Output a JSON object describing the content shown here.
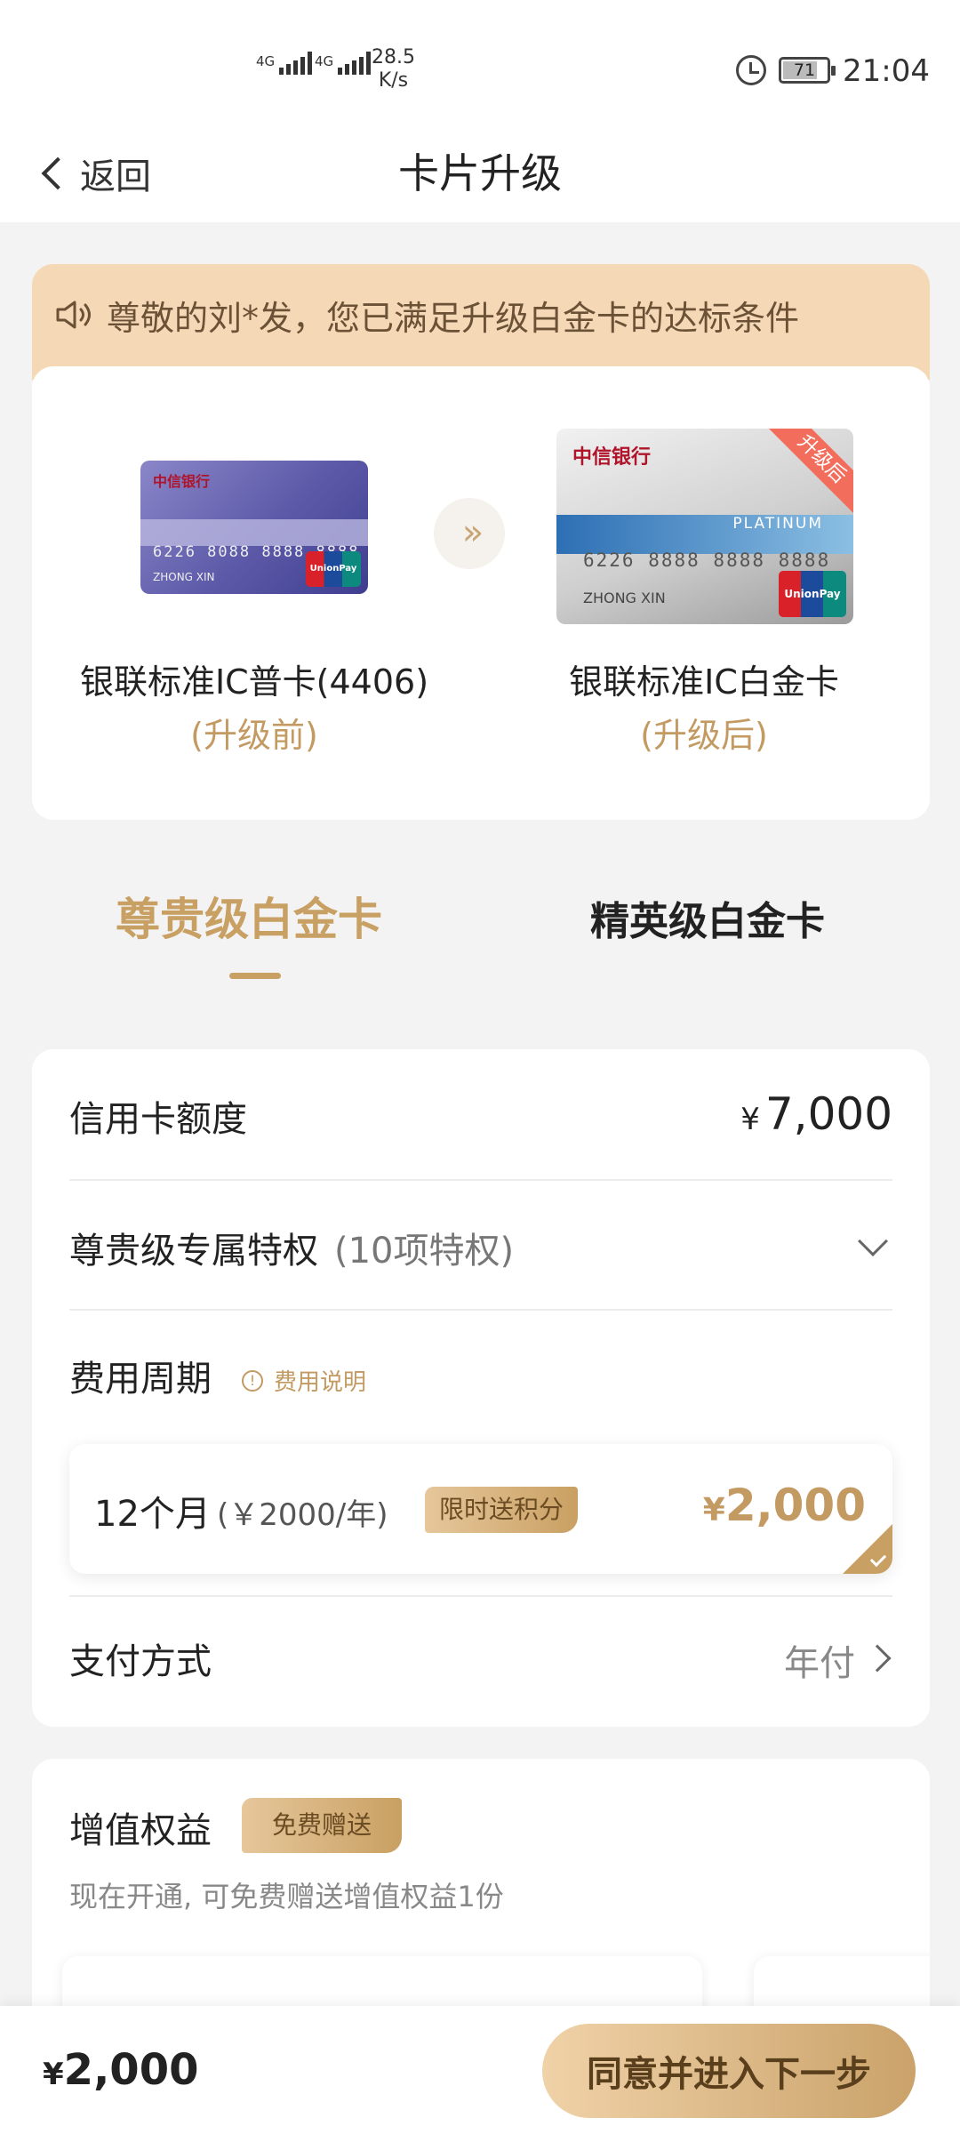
{
  "status_bar": {
    "net1": "4G",
    "net2": "4G",
    "speed_value": "28.5",
    "speed_unit": "K/s",
    "battery": "71",
    "time": "21:04"
  },
  "header": {
    "back_label": "返回",
    "title": "卡片升级"
  },
  "notice": {
    "text": "尊敬的刘*发，您已满足升级白金卡的达标条件"
  },
  "upgrade": {
    "before": {
      "name": "银联标准IC普卡(4406)",
      "sub": "(升级前)",
      "bank": "中信银行",
      "number": "6226 8088 8888 8888",
      "holder": "ZHONG XIN",
      "network": "UnionPay 银联"
    },
    "after": {
      "name": "银联标准IC白金卡",
      "sub": "(升级后)",
      "bank": "中信银行",
      "number": "6226 8888 8888 8888",
      "holder": "ZHONG XIN",
      "level": "PLATINUM",
      "network": "UnionPay 银联",
      "ribbon": "升级后"
    },
    "arrow": "»"
  },
  "tabs": [
    {
      "label": "尊贵级白金卡",
      "active": true
    },
    {
      "label": "精英级白金卡",
      "active": false
    }
  ],
  "details": {
    "limit_label": "信用卡额度",
    "limit_currency": "¥",
    "limit_value": "7,000",
    "privilege_label": "尊贵级专属特权",
    "privilege_count": "(10项特权)",
    "fee_label": "费用周期",
    "fee_note": "费用说明",
    "period": {
      "label": "12个月",
      "price": "(￥2000/年)",
      "promo": "限时送积分",
      "currency": "¥",
      "amount": "2,000",
      "selected": true
    },
    "payment_label": "支付方式",
    "payment_value": "年付"
  },
  "value_add": {
    "title": "增值权益",
    "tag": "免费赠送",
    "subtitle": "现在开通, 可免费赠送增值权益1份"
  },
  "bottom": {
    "currency": "¥",
    "total": "2,000",
    "button": "同意并进入下一步"
  },
  "colors": {
    "accent": "#c9a063",
    "accent_text": "#c39a62",
    "notice_bg": "#f5d9b7",
    "ribbon": "#f26d5b"
  }
}
